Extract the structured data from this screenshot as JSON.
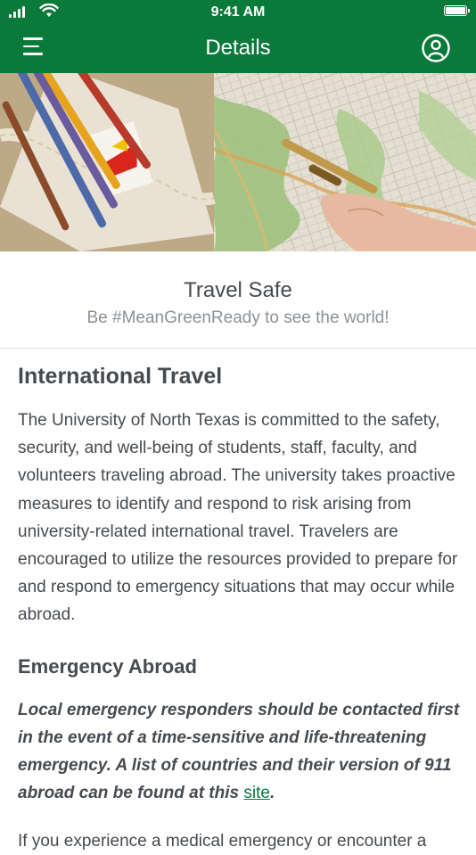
{
  "status_bar": {
    "time": "9:41 AM"
  },
  "nav": {
    "title": "Details"
  },
  "intro": {
    "title": "Travel Safe",
    "subtitle": "Be #MeanGreenReady to see the world!"
  },
  "international": {
    "heading": "International Travel",
    "body": "The University of North Texas is committed to the safety, security, and well-being of students, staff, faculty, and volunteers traveling abroad. The university takes proactive measures to identify and respond to risk arising from university-related international travel. Travelers are encouraged to utilize the resources provided to prepare for and respond to emergency situations that may occur while abroad."
  },
  "emergency": {
    "heading": "Emergency Abroad",
    "body_prefix": "Local emergency responders should be contacted first in the event of a time-sensitive and life-threatening emergency.  A list of countries and their version of 911 abroad can be found at this ",
    "link_text": "site",
    "body_suffix": ".",
    "next_line": "If you experience a medical emergency or encounter a"
  },
  "colors": {
    "brand_green": "#0a7a3a",
    "text": "#454b50",
    "muted": "#8a9198"
  },
  "icons": {
    "menu": "hamburger-menu-icon",
    "profile": "user-circle-icon",
    "signal": "cellular-signal-icon",
    "wifi": "wifi-icon",
    "battery": "battery-icon"
  }
}
